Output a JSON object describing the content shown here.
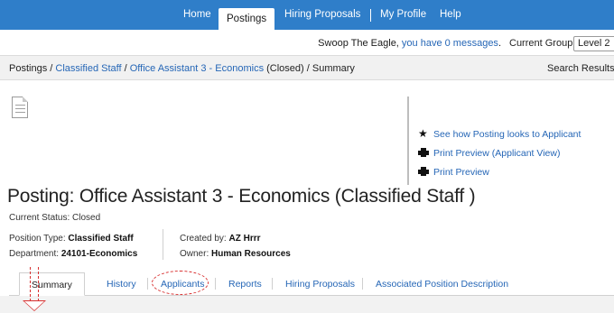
{
  "nav": {
    "items": [
      "Home",
      "Postings",
      "Hiring Proposals",
      "My Profile",
      "Help"
    ],
    "active": "Postings"
  },
  "userbar": {
    "greeting_prefix": "Swoop The Eagle, ",
    "messages_link": "you have 0 messages",
    "greeting_suffix": ".",
    "current_group_label": "Current Group:",
    "current_group_value": "Level 2"
  },
  "breadcrumb": {
    "root": "Postings",
    "sep": " / ",
    "category": "Classified Staff",
    "posting": "Office Assistant 3 - Economics",
    "posting_status": " (Closed)",
    "page": "Summary",
    "search_results": "Search Results:"
  },
  "actions": {
    "see_how": "See how Posting looks to Applicant",
    "print_preview_applicant": "Print Preview (Applicant View)",
    "print_preview": "Print Preview"
  },
  "posting": {
    "title": "Posting: Office Assistant 3 - Economics (Classified Staff )",
    "status_label": "Current Status: ",
    "status_value": "Closed",
    "position_type_label": "Position Type: ",
    "position_type_value": "Classified Staff",
    "department_label": "Department: ",
    "department_value": "24101-Economics",
    "created_by_label": "Created by: ",
    "created_by_value": "AZ Hrrr",
    "owner_label": "Owner: ",
    "owner_value": "Human Resources"
  },
  "tabs": [
    "Summary",
    "History",
    "Applicants",
    "Reports",
    "Hiring Proposals",
    "Associated Position Description"
  ],
  "colors": {
    "nav_bg": "#2f7ec9",
    "link": "#2566b6",
    "annotation": "#d83030"
  }
}
